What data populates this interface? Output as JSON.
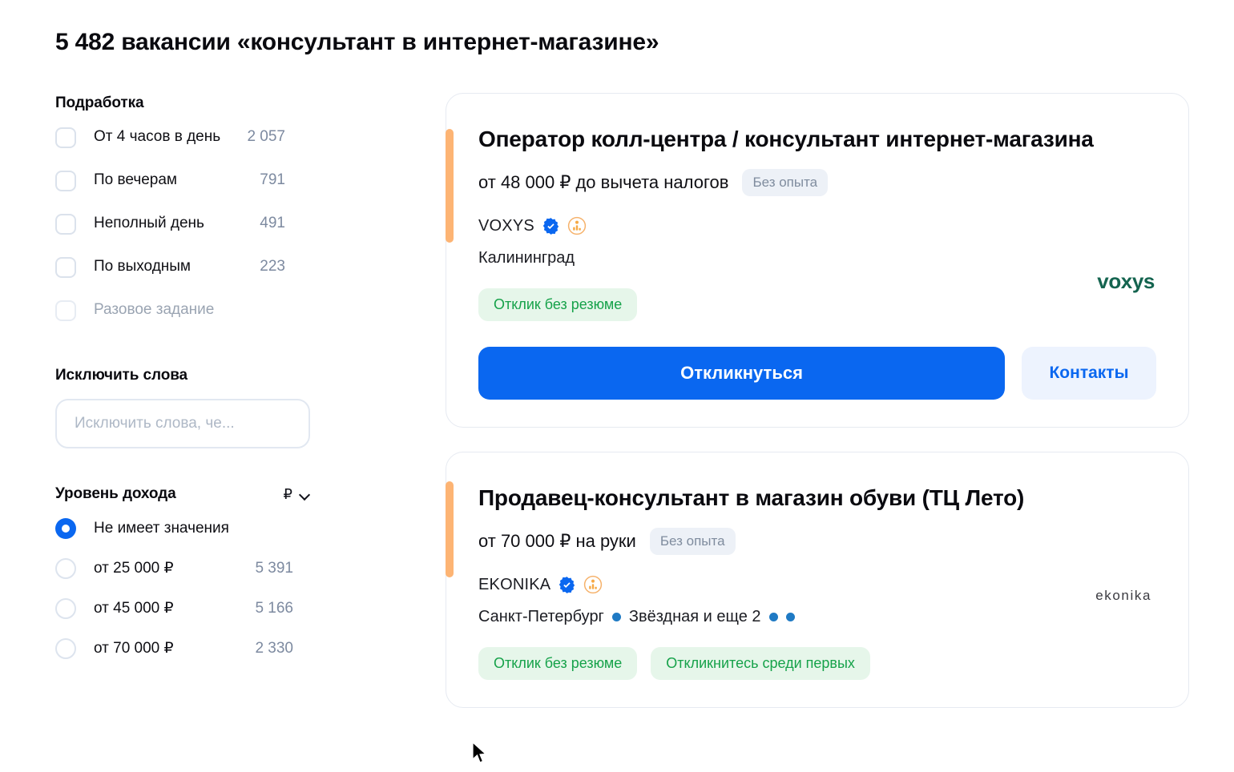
{
  "page": {
    "title": "5 482 вакансии «консультант в интернет-магазине»"
  },
  "sidebar": {
    "part_time": {
      "heading": "Подработка",
      "items": [
        {
          "label": "От 4 часов в день",
          "count": "2 057",
          "checked": false,
          "disabled": false
        },
        {
          "label": "По вечерам",
          "count": "791",
          "checked": false,
          "disabled": false
        },
        {
          "label": "Неполный день",
          "count": "491",
          "checked": false,
          "disabled": false
        },
        {
          "label": "По выходным",
          "count": "223",
          "checked": false,
          "disabled": false
        },
        {
          "label": "Разовое задание",
          "count": "",
          "checked": false,
          "disabled": true
        }
      ]
    },
    "exclude": {
      "heading": "Исключить слова",
      "input_value": "",
      "placeholder": "Исключить слова, че..."
    },
    "income": {
      "heading": "Уровень дохода",
      "currency": "₽",
      "currency_icon": "chevron-down-icon",
      "items": [
        {
          "label": "Не имеет значения",
          "count": "",
          "selected": true
        },
        {
          "label": "от 25 000 ₽",
          "count": "5 391",
          "selected": false
        },
        {
          "label": "от 45 000 ₽",
          "count": "5 166",
          "selected": false
        },
        {
          "label": "от 70 000 ₽",
          "count": "2 330",
          "selected": false
        }
      ]
    }
  },
  "results": [
    {
      "title": "Оператор колл-центра / консультант интернет-магазина",
      "salary": "от 48 000 ₽ до вычета налогов",
      "experience_badge": "Без опыта",
      "company": "VOXYS",
      "company_logo_text": "voxys",
      "verified_icon": "verified-check-icon",
      "trusted_icon": "trusted-employer-icon",
      "location": "Калининград",
      "metro": "",
      "metro_extra": "",
      "tags": [
        "Отклик без резюме"
      ],
      "apply_label": "Откликнуться",
      "contacts_label": "Контакты"
    },
    {
      "title": "Продавец-консультант в магазин обуви (ТЦ Лето)",
      "salary": "от 70 000 ₽ на руки",
      "experience_badge": "Без опыта",
      "company": "EKONIKA",
      "company_logo_text": "ekonika",
      "verified_icon": "verified-check-icon",
      "trusted_icon": "trusted-employer-icon",
      "location": "Санкт-Петербург",
      "metro": "Звёздная и еще 2",
      "tags": [
        "Отклик без резюме",
        "Откликнитесь среди первых"
      ]
    }
  ],
  "colors": {
    "accent_blue": "#0a67f0",
    "accent_orange": "#fdb474",
    "tag_green_text": "#16a24a",
    "tag_green_bg": "#e6f6ea",
    "metro_dot": "#1f7ac4",
    "voxys_green": "#14644f"
  }
}
